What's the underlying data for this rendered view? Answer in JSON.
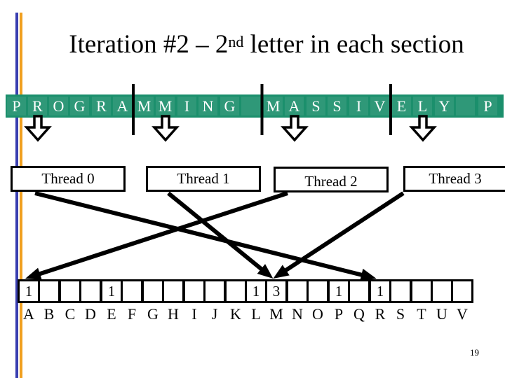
{
  "slide": {
    "title_prefix": "Iteration #2 – 2",
    "title_superscript": "nd",
    "title_suffix": " letter in each section",
    "page_number": "19"
  },
  "input_string": {
    "cells": [
      "P",
      "R",
      "O",
      "G",
      "R",
      "A",
      "M",
      "M",
      "I",
      "N",
      "G",
      "",
      "M",
      "A",
      "S",
      "S",
      "I",
      "V",
      "E",
      "L",
      "Y",
      "",
      "P"
    ],
    "section_separators_after_index": [
      5,
      11,
      17
    ],
    "highlighted_indices": [
      1,
      7,
      13,
      19
    ]
  },
  "threads": [
    {
      "label": "Thread 0",
      "reads": "R",
      "writes_to": "R"
    },
    {
      "label": "Thread 1",
      "reads": "M",
      "writes_to": "M"
    },
    {
      "label": "Thread 2",
      "reads": "A",
      "writes_to": "A"
    },
    {
      "label": "Thread 3",
      "reads": "L",
      "writes_to": "M"
    }
  ],
  "histogram": {
    "letters": [
      "A",
      "B",
      "C",
      "D",
      "E",
      "F",
      "G",
      "H",
      "I",
      "J",
      "K",
      "L",
      "M",
      "N",
      "O",
      "P",
      "Q",
      "R",
      "S",
      "T",
      "U",
      "V"
    ],
    "counts": [
      "1",
      "",
      "",
      "",
      "1",
      "",
      "",
      "",
      "",
      "",
      "",
      "1",
      "3",
      "",
      "",
      "1",
      "",
      "1",
      "",
      "",
      "",
      ""
    ]
  },
  "colors": {
    "band": "#1b8f6c",
    "cell": "#2f9878",
    "accent_blue": "#3a3fb0",
    "accent_orange": "#f0a020"
  }
}
